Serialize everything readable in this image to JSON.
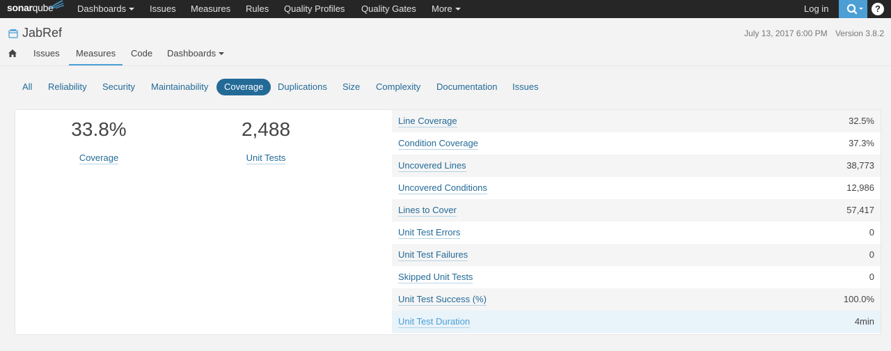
{
  "topnav": {
    "logo_sonar": "sonar",
    "logo_qube": "qube",
    "items": [
      {
        "label": "Dashboards",
        "caret": true
      },
      {
        "label": "Issues"
      },
      {
        "label": "Measures"
      },
      {
        "label": "Rules"
      },
      {
        "label": "Quality Profiles"
      },
      {
        "label": "Quality Gates"
      },
      {
        "label": "More",
        "caret": true
      }
    ],
    "login": "Log in",
    "search_icon": "search-icon",
    "help": "?"
  },
  "project": {
    "icon": "project-icon",
    "title": "JabRef",
    "date": "July 13, 2017 6:00 PM",
    "version": "Version 3.8.2"
  },
  "project_tabs": [
    {
      "label": "",
      "icon": "home-icon"
    },
    {
      "label": "Issues"
    },
    {
      "label": "Measures",
      "active": true
    },
    {
      "label": "Code"
    },
    {
      "label": "Dashboards",
      "caret": true
    }
  ],
  "domains": [
    {
      "label": "All"
    },
    {
      "label": "Reliability"
    },
    {
      "label": "Security"
    },
    {
      "label": "Maintainability"
    },
    {
      "label": "Coverage",
      "active": true
    },
    {
      "label": "Duplications"
    },
    {
      "label": "Size"
    },
    {
      "label": "Complexity"
    },
    {
      "label": "Documentation"
    },
    {
      "label": "Issues"
    }
  ],
  "main": {
    "coverage_value": "33.8%",
    "coverage_label": "Coverage",
    "tests_value": "2,488",
    "tests_label": "Unit Tests"
  },
  "measures": [
    {
      "name": "Line Coverage",
      "value": "32.5%"
    },
    {
      "name": "Condition Coverage",
      "value": "37.3%"
    },
    {
      "name": "Uncovered Lines",
      "value": "38,773"
    },
    {
      "name": "Uncovered Conditions",
      "value": "12,986"
    },
    {
      "name": "Lines to Cover",
      "value": "57,417"
    },
    {
      "name": "Unit Test Errors",
      "value": "0"
    },
    {
      "name": "Unit Test Failures",
      "value": "0"
    },
    {
      "name": "Skipped Unit Tests",
      "value": "0"
    },
    {
      "name": "Unit Test Success (%)",
      "value": "100.0%"
    },
    {
      "name": "Unit Test Duration",
      "value": "4min",
      "selected": true
    }
  ],
  "colors": {
    "accent": "#4b9fd5",
    "link": "#236a97",
    "navbar": "#262626"
  }
}
